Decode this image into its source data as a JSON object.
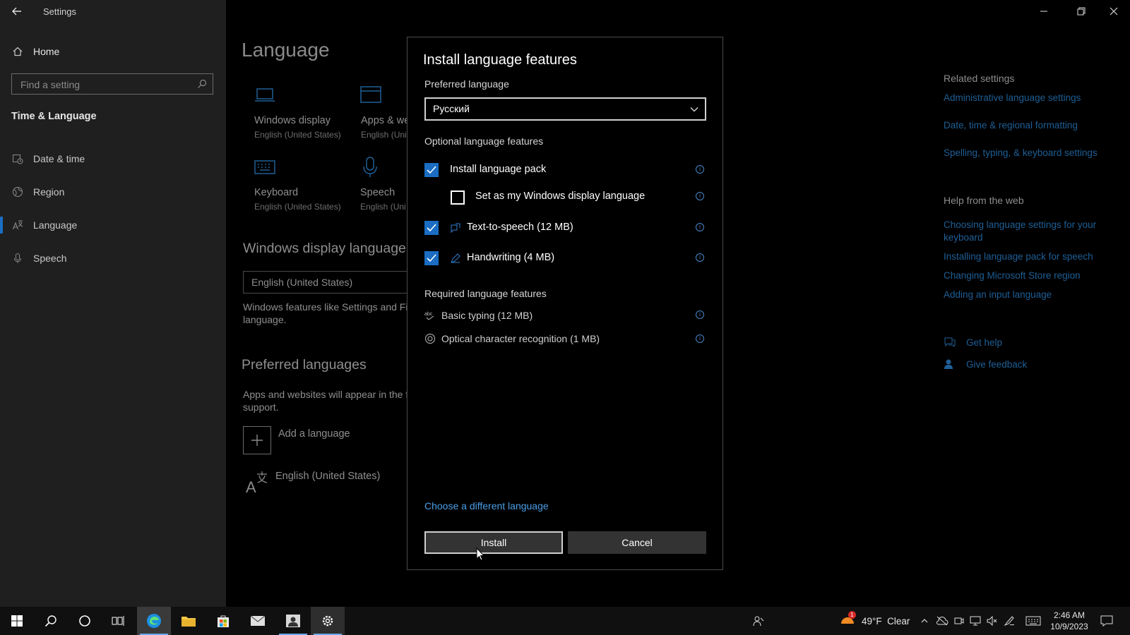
{
  "window": {
    "title": "Settings"
  },
  "sidebar": {
    "home_label": "Home",
    "search_placeholder": "Find a setting",
    "section_title": "Time & Language",
    "items": [
      {
        "label": "Date & time",
        "icon": "calendar-clock-icon"
      },
      {
        "label": "Region",
        "icon": "globe-icon"
      },
      {
        "label": "Language",
        "icon": "language-icon"
      },
      {
        "label": "Speech",
        "icon": "microphone-icon"
      }
    ]
  },
  "main": {
    "page_title": "Language",
    "tiles": [
      {
        "label": "Windows display",
        "sub": "English (United States)",
        "icon": "laptop-icon"
      },
      {
        "label": "Apps & we",
        "sub": "English (Uni",
        "icon": "browser-window-icon"
      },
      {
        "label": "Keyboard",
        "sub": "English (United States)",
        "icon": "keyboard-icon"
      },
      {
        "label": "Speech",
        "sub": "English (Uni",
        "icon": "microphone-icon"
      }
    ],
    "display_language_heading": "Windows display language",
    "display_language_value": "English (United States)",
    "display_language_desc_1": "Windows features like Settings and Fil",
    "display_language_desc_2": "language.",
    "preferred_heading": "Preferred languages",
    "preferred_desc_1": "Apps and websites will appear in the f",
    "preferred_desc_2": "support.",
    "add_language_label": "Add a language",
    "installed_language": "English (United States)"
  },
  "right_panel": {
    "related_heading": "Related settings",
    "related_links": [
      "Administrative language settings",
      "Date, time & regional formatting",
      "Spelling, typing, & keyboard settings"
    ],
    "help_heading": "Help from the web",
    "help_links": [
      "Choosing language settings for your",
      "keyboard",
      "Installing language pack for speech",
      "Changing Microsoft Store region",
      "Adding an input language"
    ],
    "get_help": "Get help",
    "give_feedback": "Give feedback"
  },
  "dialog": {
    "title": "Install language features",
    "preferred_label": "Preferred language",
    "preferred_value": "Русский",
    "optional_heading": "Optional language features",
    "install_pack": {
      "label": "Install language pack",
      "checked": true
    },
    "set_display": {
      "label": "Set as my Windows display language",
      "checked": false
    },
    "tts": {
      "label": "Text-to-speech (12 MB)",
      "checked": true
    },
    "handwriting": {
      "label": "Handwriting (4 MB)",
      "checked": true
    },
    "required_heading": "Required language features",
    "basic_typing": "Basic typing (12 MB)",
    "ocr": "Optical character recognition (1 MB)",
    "choose_different": "Choose a different language",
    "install_button": "Install",
    "cancel_button": "Cancel"
  },
  "taskbar": {
    "weather_badge": "1",
    "weather": "49°F  Clear",
    "time": "2:46 AM",
    "date": "10/9/2023"
  },
  "colors": {
    "accent": "#1a6dc3",
    "link": "#4a9fe8",
    "sidebar_bg": "#1f1f1f",
    "dialog_bg": "#000000"
  }
}
